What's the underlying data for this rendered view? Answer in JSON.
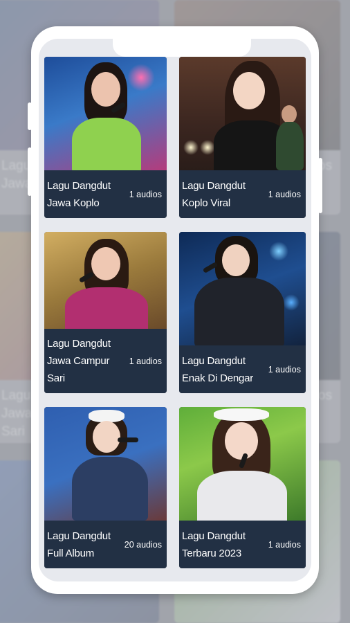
{
  "background_tiles": [
    {
      "caption": "Lagu\nJawa"
    },
    {
      "caption": "os"
    },
    {
      "caption": "Lagu\nJawa\nSari"
    },
    {
      "caption": "os"
    }
  ],
  "cards": [
    {
      "title": "Lagu Dangdut\nJawa Koplo",
      "count": "1 audios",
      "colors": [
        "#2f5fa8",
        "#8fd14f",
        "#e8b9a5"
      ]
    },
    {
      "title": "Lagu Dangdut\nKoplo Viral",
      "count": "1 audios",
      "colors": [
        "#5a3a2c",
        "#1b1b1b",
        "#f3d6c4"
      ]
    },
    {
      "title": "Lagu Dangdut\nJawa Campur\nSari",
      "count": "1 audios",
      "colors": [
        "#c6a15a",
        "#b22f70",
        "#efc8b3"
      ]
    },
    {
      "title": "Lagu Dangdut\nEnak Di Dengar",
      "count": "1 audios",
      "colors": [
        "#1c3a64",
        "#20232b",
        "#f0d2c0"
      ]
    },
    {
      "title": "Lagu Dangdut\nFull Album",
      "count": "20 audios",
      "colors": [
        "#3a61b0",
        "#2c3e63",
        "#f2d5c4"
      ]
    },
    {
      "title": "Lagu Dangdut\nTerbaru 2023",
      "count": "1 audios",
      "colors": [
        "#5fae3a",
        "#e9e9ec",
        "#f4d8c9"
      ]
    }
  ]
}
